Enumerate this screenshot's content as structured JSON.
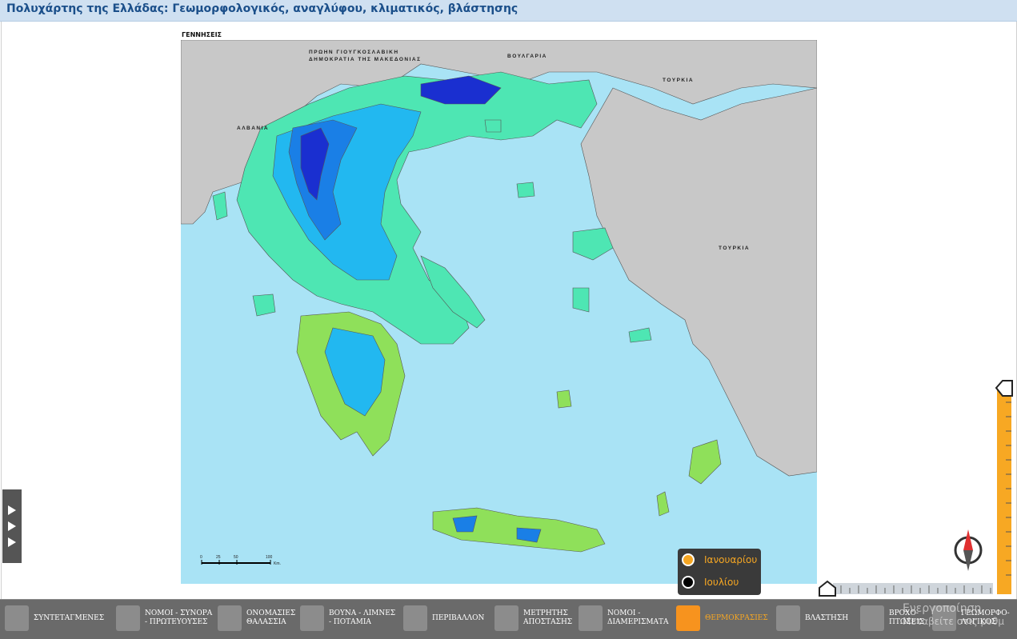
{
  "title": "Πολυχάρτης της Ελλάδας: Γεωμορφολογικός, αναγλύφου, κλιματικός, βλάστησης",
  "map": {
    "header_label": "ΓΕΝΝΗΣΕΙΣ",
    "country_labels": {
      "fyrom": "ΠΡΩΗΝ ΓΙΟΥΓΚΟΣΛΑΒΙΚΗ ΔΗΜΟΚΡΑΤΙΑ ΤΗΣ ΜΑΚΕΔΟΝΙΑΣ",
      "fyrom_line1": "ΠΡΩΗΝ ΓΙΟΥΓΚΟΣΛΑΒΙΚΗ",
      "fyrom_line2": "ΔΗΜΟΚΡΑΤΙΑ ΤΗΣ ΜΑΚΕΔΟΝΙΑΣ",
      "bulgaria": "ΒΟΥΛΓΑΡΙΑ",
      "turkey_north": "ΤΟΥΡΚΙΑ",
      "albania": "ΑΛΒΑΝΙΑ",
      "turkey_east": "ΤΟΥΡΚΙΑ"
    },
    "scale_ticks": [
      "0",
      "25",
      "50",
      "100"
    ],
    "scale_unit": "Km.",
    "colors": {
      "sea": "#a9e3f5",
      "neighbor_land": "#c8c8c8",
      "low": "#4ee6b3",
      "mid": "#22b8f0",
      "high": "#1a7fe6",
      "peak": "#1a2fd0",
      "warm": "#8fe05a"
    }
  },
  "legend": {
    "options": [
      {
        "label": "Ιανουαρίου",
        "selected": true
      },
      {
        "label": "Ιουλίου",
        "selected": false
      }
    ],
    "accent": "#f5a623"
  },
  "toolbar": {
    "items": [
      {
        "label_lines": [
          "ΣΥΝΤΕΤΑΓΜΕΝΕΣ"
        ],
        "icon": "globe-grid-icon",
        "active": false
      },
      {
        "label_lines": [
          "ΝΟΜΟΙ - ΣΥΝΟΡΑ",
          "- ΠΡΩΤΕΥΟΥΣΕΣ"
        ],
        "icon": "map-pin-icon",
        "active": false
      },
      {
        "label_lines": [
          "ΟΝΟΜΑΣΙΕΣ",
          "ΘΑΛΑΣΣΙΑ"
        ],
        "icon": "letter-a-icon",
        "active": false
      },
      {
        "label_lines": [
          "ΒΟΥΝΑ - ΛΙΜΝΕΣ",
          "- ΠΟΤΑΜΙΑ"
        ],
        "icon": "mountain-river-icon",
        "active": false
      },
      {
        "label_lines": [
          "ΠΕΡΙΒΑΛΛΟΝ"
        ],
        "icon": "leaf-icon",
        "active": false
      },
      {
        "label_lines": [
          "ΜΕΤΡΗΤΗΣ",
          "ΑΠΟΣΤΑΣΗΣ"
        ],
        "icon": "measure-disc-icon",
        "active": false
      },
      {
        "label_lines": [
          "ΝΟΜΟΙ -",
          "ΔΙΑΜΕΡΙΣΜΑΤΑ"
        ],
        "icon": "folded-map-icon",
        "active": false
      },
      {
        "label_lines": [
          "ΘΕΡΜΟΚΡΑΣΙΕΣ"
        ],
        "icon": "thermometer-icon",
        "active": true
      },
      {
        "label_lines": [
          "ΒΛΑΣΤΗΣΗ"
        ],
        "icon": "palm-tree-icon",
        "active": false
      },
      {
        "label_lines": [
          "ΒΡΟΧΟ-",
          "ΠΤΩΣΕΙΣ"
        ],
        "icon": "rain-cloud-icon",
        "active": false
      },
      {
        "label_lines": [
          "ΓΕΩΜΟΡΦΟ-",
          "ΛΟΓΙΚΟΣ"
        ],
        "icon": "relief-icon",
        "active": false
      }
    ]
  },
  "watermark": {
    "line1": "Ενεργοποίηση",
    "line2": "Μεταβείτε στις ρυθμ"
  }
}
